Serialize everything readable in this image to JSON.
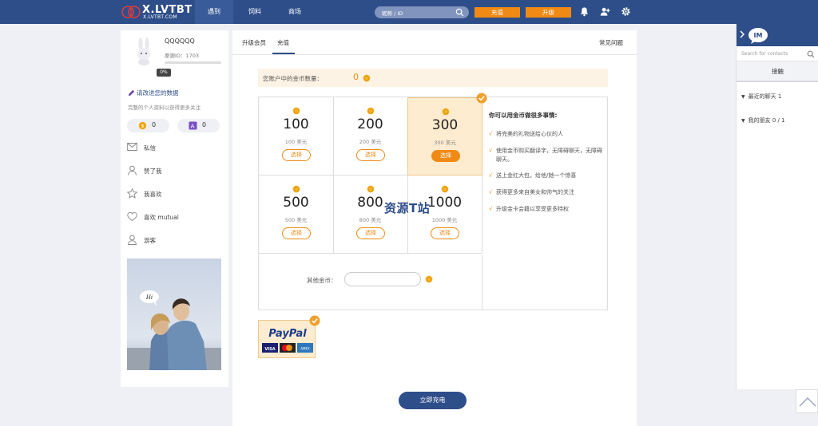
{
  "header": {
    "logo_title": "X.LVTBT",
    "logo_sub": "X.LVTBT.COM",
    "nav": [
      {
        "label": "遇到",
        "active": true
      },
      {
        "label": "饲料",
        "active": false
      },
      {
        "label": "商场",
        "active": false
      }
    ],
    "search_placeholder": "昵称 / ID",
    "recharge_label": "充值",
    "upgrade_label": "升级",
    "icons": [
      "bell-icon",
      "add-user-icon",
      "gear-icon"
    ]
  },
  "profile": {
    "username": "QQQQQQ",
    "id_label": "原源ID：1703",
    "progress_percent": 0,
    "progress_label": "0%",
    "improve_link": "请改进您的数据",
    "improve_hint": "完整的个人资料以获得更多关注",
    "coins": "0",
    "points": "0",
    "menu": [
      {
        "icon": "mail-icon",
        "label": "私信"
      },
      {
        "icon": "user-icon",
        "label": "赞了我"
      },
      {
        "icon": "star-icon",
        "label": "我喜欢"
      },
      {
        "icon": "heart-icon",
        "label": "喜欢 mutual"
      },
      {
        "icon": "visitor-icon",
        "label": "游客"
      }
    ],
    "photo_bubble": "Hi"
  },
  "main": {
    "tabs": [
      {
        "label": "升级会员",
        "active": false
      },
      {
        "label": "充值",
        "active": true
      }
    ],
    "faq": "常见问题",
    "balance_label": "您账户中的金币数量：",
    "balance_value": "0",
    "packages": [
      {
        "amount": "100",
        "price": "100 美元",
        "button": "选择",
        "selected": false
      },
      {
        "amount": "200",
        "price": "200 美元",
        "button": "选择",
        "selected": false
      },
      {
        "amount": "300",
        "price": "300 美元",
        "button": "选择",
        "selected": true
      },
      {
        "amount": "500",
        "price": "500 美元",
        "button": "选择",
        "selected": false
      },
      {
        "amount": "800",
        "price": "800 美元",
        "button": "选择",
        "selected": false
      },
      {
        "amount": "1000",
        "price": "1000 美元",
        "button": "选择",
        "selected": false
      }
    ],
    "other_label": "其他金币：",
    "benefits_title": "你可以用金币做很多事情:",
    "benefits": [
      "将完美的礼物送给心仪的人",
      "使用金币购买翻译字，无障碍聊天，无障碍聊天。",
      "送上金红大包，给他/她一个惊喜",
      "获得更多来自美女和帅气的关注",
      "升级金卡会籍以享受更多特权"
    ],
    "payment_method": "PayPal",
    "payment_cards": [
      "VISA",
      "MasterCard",
      "AMEX"
    ],
    "pay_button": "立即充电",
    "watermark": "资源T站"
  },
  "im": {
    "badge": "IM",
    "search_placeholder": "Search for contacts",
    "tab": "接触",
    "groups": [
      {
        "label": "最近的聊天",
        "count": "1"
      },
      {
        "label": "我的朋友",
        "count": "0 / 1"
      }
    ]
  },
  "colors": {
    "primary": "#2e4e8a",
    "accent": "#f08a14",
    "selected_bg": "#fdeccf"
  }
}
